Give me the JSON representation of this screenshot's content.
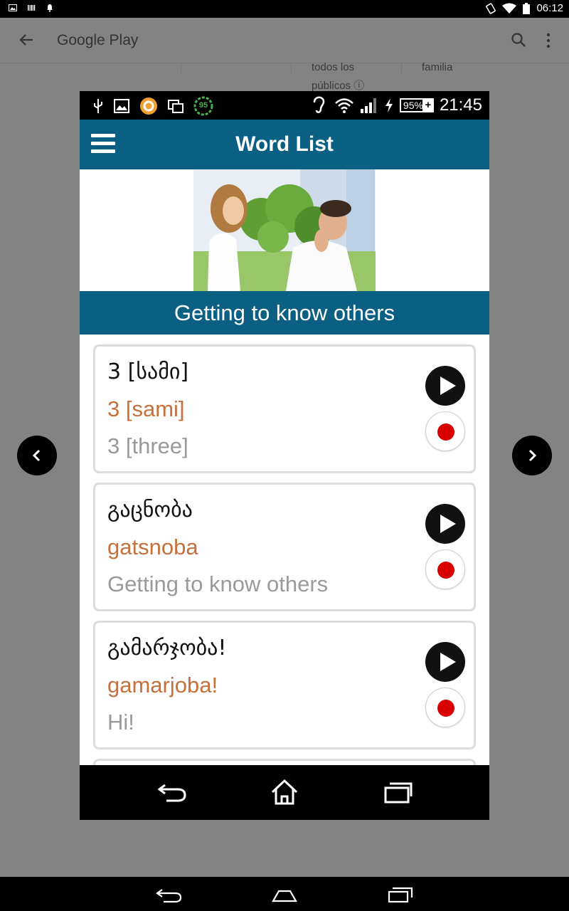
{
  "outer_status": {
    "time": "06:12"
  },
  "background": {
    "store_title": "Google Play",
    "rating_text_1": "todos los",
    "rating_text_2": "públicos ⓘ",
    "category_text": "familia"
  },
  "inner_status": {
    "battery": "95%",
    "time": "21:45",
    "badge": "95"
  },
  "app": {
    "title": "Word List",
    "section_title": "Getting to know others"
  },
  "words": [
    {
      "native": "3 [სამი]",
      "transliteration": "3 [sami]",
      "english": "3 [three]"
    },
    {
      "native": "გაცნობა",
      "transliteration": "gatsnoba",
      "english": "Getting to know others"
    },
    {
      "native": "გამარჯობა!",
      "transliteration": "gamarjoba!",
      "english": "Hi!"
    }
  ],
  "colors": {
    "app_bar": "#0a5f82",
    "transliteration": "#c8703a",
    "english": "#9a9a9a",
    "record_dot": "#d80000"
  }
}
